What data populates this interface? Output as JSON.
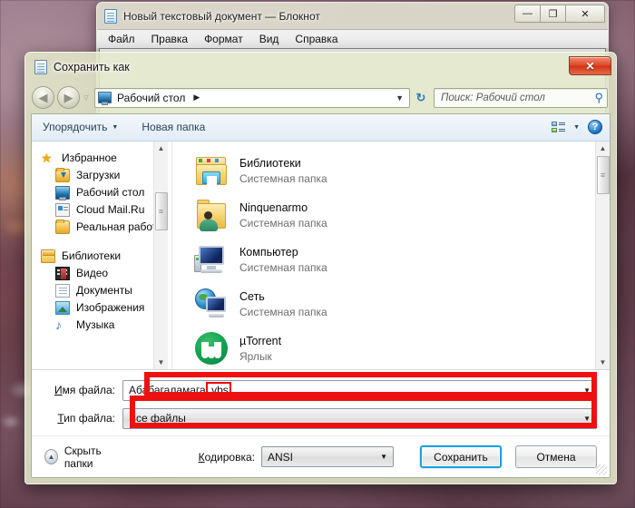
{
  "desktop": {
    "name": "desktop-wallpaper"
  },
  "notepad": {
    "title": "Новый текстовый документ — Блокнот",
    "icon": "notepad-icon",
    "buttons": {
      "minimize": "—",
      "maximize": "❐",
      "close": "✕"
    },
    "menu": [
      "Файл",
      "Правка",
      "Формат",
      "Вид",
      "Справка"
    ]
  },
  "dialog": {
    "title": "Сохранить как",
    "icon": "notepad-icon",
    "close_label": "✕",
    "nav": {
      "back_glyph": "◀",
      "forward_glyph": "▶",
      "recent_caret": "▽"
    },
    "address": {
      "icon": "desktop-icon",
      "path": "Рабочий стол",
      "separator": "▶",
      "caret": "▼",
      "refresh_glyph": "↻"
    },
    "search": {
      "placeholder": "Поиск: Рабочий стол",
      "icon": "search-icon"
    },
    "commandbar": {
      "organize": "Упорядочить",
      "organize_caret": "▼",
      "new_folder": "Новая папка",
      "view_caret": "▼",
      "help_label": "?"
    },
    "navpane": {
      "groups": [
        {
          "label": "Избранное",
          "icon": "star-icon",
          "icon_class": "ni-star",
          "children": [
            {
              "label": "Загрузки",
              "icon": "downloads-folder-icon",
              "icon_class": "ni-folder ni-dl"
            },
            {
              "label": "Рабочий стол",
              "icon": "desktop-icon",
              "icon_class": "ni-desk"
            },
            {
              "label": "Cloud Mail.Ru",
              "icon": "cloud-mail-icon",
              "icon_class": "ni-cloud"
            },
            {
              "label": "Реальная работ",
              "icon": "folder-icon",
              "icon_class": "ni-folder"
            }
          ]
        },
        {
          "label": "Библиотеки",
          "icon": "libraries-icon",
          "icon_class": "ni-lib",
          "children": [
            {
              "label": "Видео",
              "icon": "video-library-icon",
              "icon_class": "ni-video"
            },
            {
              "label": "Документы",
              "icon": "documents-library-icon",
              "icon_class": "ni-doc"
            },
            {
              "label": "Изображения",
              "icon": "pictures-library-icon",
              "icon_class": "ni-img"
            },
            {
              "label": "Музыка",
              "icon": "music-library-icon",
              "icon_class": "ni-music"
            }
          ]
        }
      ]
    },
    "filelist": [
      {
        "name": "Библиотеки",
        "sub": "Системная папка",
        "icon": "libraries-icon",
        "icon_class": "ic-libs"
      },
      {
        "name": "Ninquenarmo",
        "sub": "Системная папка",
        "icon": "user-folder-icon",
        "icon_class": "ic-user"
      },
      {
        "name": "Компьютер",
        "sub": "Системная папка",
        "icon": "computer-icon",
        "icon_class": "ic-pc"
      },
      {
        "name": "Сеть",
        "sub": "Системная папка",
        "icon": "network-icon",
        "icon_class": "ic-net"
      },
      {
        "name": "µTorrent",
        "sub": "Ярлык",
        "icon": "utorrent-icon",
        "icon_class": "ic-ut"
      }
    ],
    "form": {
      "filename_label": "Имя файла:",
      "filename_label_accel": "И",
      "filename_label_rest": "мя файла:",
      "filename_value_base": "Абабагаламага",
      "filename_value_ext": ".vbs",
      "filetype_label_accel": "Т",
      "filetype_label_rest": "ип файла:",
      "filetype_value": "Все файлы",
      "caret": "▼"
    },
    "footer": {
      "hide_folders": "Скрыть папки",
      "hide_folders_glyph": "▲",
      "encoding_label_accel": "К",
      "encoding_label_rest": "одировка:",
      "encoding_value": "ANSI",
      "save_button": "Сохранить",
      "cancel_button": "Отмена"
    },
    "highlights": {
      "filename_box_color": "#ee1111",
      "filetype_box_color": "#ee1111",
      "extension_box_color": "#ee0000"
    }
  }
}
